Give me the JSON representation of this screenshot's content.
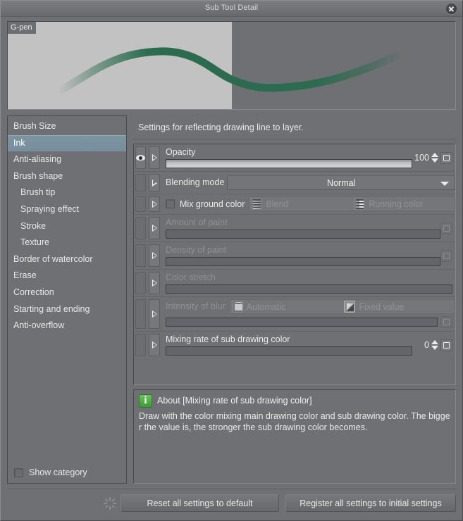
{
  "window": {
    "title": "Sub Tool Detail",
    "close_icon": "close-icon"
  },
  "preview": {
    "tool_name": "G-pen",
    "stroke_color": "#2b6b4f",
    "light_bg": "#c2c2c2",
    "dark_bg": "#6f7073"
  },
  "sidebar": {
    "items": [
      {
        "label": "Brush Size",
        "indent": false,
        "selected": false
      },
      {
        "label": "Ink",
        "indent": false,
        "selected": true
      },
      {
        "label": "Anti-aliasing",
        "indent": false,
        "selected": false
      },
      {
        "label": "Brush shape",
        "indent": false,
        "selected": false
      },
      {
        "label": "Brush tip",
        "indent": true,
        "selected": false
      },
      {
        "label": "Spraying effect",
        "indent": true,
        "selected": false
      },
      {
        "label": "Stroke",
        "indent": true,
        "selected": false
      },
      {
        "label": "Texture",
        "indent": true,
        "selected": false
      },
      {
        "label": "Border of watercolor",
        "indent": false,
        "selected": false
      },
      {
        "label": "Erase",
        "indent": false,
        "selected": false
      },
      {
        "label": "Correction",
        "indent": false,
        "selected": false
      },
      {
        "label": "Starting and ending",
        "indent": false,
        "selected": false
      },
      {
        "label": "Anti-overflow",
        "indent": false,
        "selected": false
      }
    ],
    "show_category_label": "Show category",
    "show_category_checked": false,
    "selected_highlight": "#7d93a0"
  },
  "main": {
    "description": "Settings for reflecting drawing line to layer.",
    "rows": {
      "opacity": {
        "label": "Opacity",
        "value": "100",
        "slider_percent": 100,
        "eye_icon": "eye-icon",
        "expand_icon": "triangle-right-icon",
        "indicator_icon": "square-indicator-icon"
      },
      "blending_mode": {
        "label": "Blending mode",
        "value": "Normal",
        "options": [
          "Normal"
        ],
        "arrow_icon": "chevron-down-icon"
      },
      "mix_ground_color": {
        "label": "Mix ground color",
        "checked": false,
        "segments": [
          {
            "label": "Blend",
            "icon": "blend-gradient-icon",
            "enabled": false
          },
          {
            "label": "Running color",
            "icon": "running-color-icon",
            "enabled": false
          }
        ]
      },
      "amount_of_paint": {
        "label": "Amount of paint",
        "slider_percent": 0,
        "disabled": true
      },
      "density_of_paint": {
        "label": "Density of paint",
        "slider_percent": 0,
        "disabled": true
      },
      "color_stretch": {
        "label": "Color stretch",
        "slider_percent": 0,
        "disabled": true
      },
      "intensity_of_blur": {
        "label": "Intensity of blur",
        "slider_percent": 0,
        "disabled": true,
        "segments": [
          {
            "label": "Automatic",
            "icon": "automatic-icon",
            "enabled": false
          },
          {
            "label": "Fixed value",
            "icon": "fixed-value-icon",
            "enabled": false
          }
        ]
      },
      "mixing_rate": {
        "label": "Mixing rate of sub drawing color",
        "value": "0",
        "slider_percent": 0
      }
    }
  },
  "about": {
    "info_icon": "info-icon",
    "title": "About [Mixing rate of sub drawing color]",
    "body": "Draw with the color mixing main drawing color and sub drawing color. The bigger the value is, the stronger the sub drawing color becomes."
  },
  "footer": {
    "spinner_icon": "loading-spinner-icon",
    "reset_label": "Reset all settings to default",
    "register_label": "Register all settings to initial settings"
  }
}
